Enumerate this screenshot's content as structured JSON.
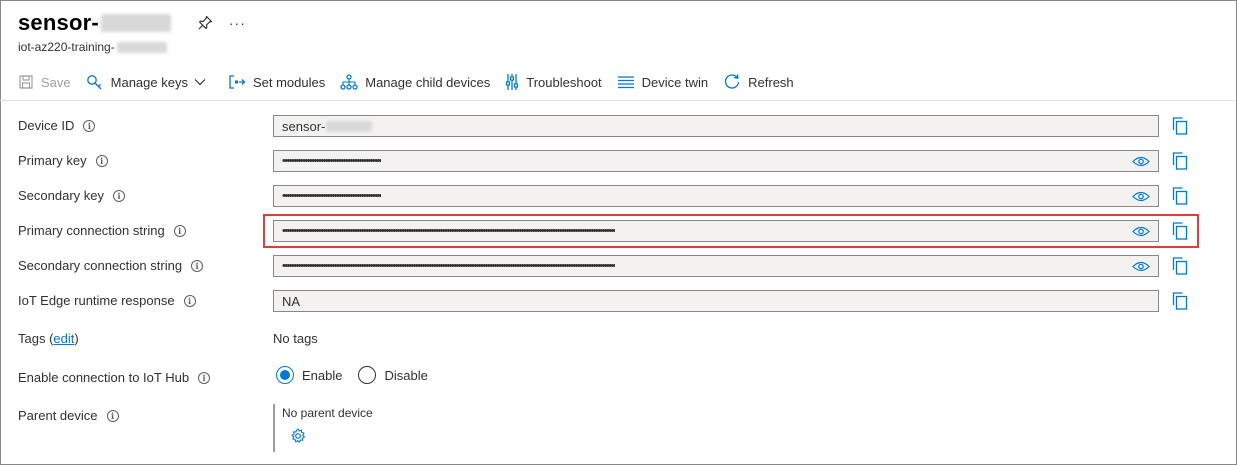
{
  "header": {
    "title": "sensor-",
    "subtitle": "iot-az220-training-",
    "more": "···"
  },
  "toolbar": {
    "save": "Save",
    "manage_keys": "Manage keys",
    "set_modules": "Set modules",
    "manage_child_devices": "Manage child devices",
    "troubleshoot": "Troubleshoot",
    "device_twin": "Device twin",
    "refresh": "Refresh"
  },
  "fields": {
    "device_id": {
      "label": "Device ID",
      "value": "sensor-"
    },
    "primary_key": {
      "label": "Primary key",
      "value": "••••••••••••••••••••••••••••••••••••••••••••"
    },
    "secondary_key": {
      "label": "Secondary key",
      "value": "••••••••••••••••••••••••••••••••••••••••••••"
    },
    "primary_conn": {
      "label": "Primary connection string",
      "value": "••••••••••••••••••••••••••••••••••••••••••••••••••••••••••••••••••••••••••••••••••••••••••••••••••••••••••••••••••••••••••••••••••••••••••••••••••••"
    },
    "secondary_conn": {
      "label": "Secondary connection string",
      "value": "••••••••••••••••••••••••••••••••••••••••••••••••••••••••••••••••••••••••••••••••••••••••••••••••••••••••••••••••••••••••••••••••••••••••••••••••••••"
    },
    "edge_runtime": {
      "label": "IoT Edge runtime response",
      "value": "NA"
    }
  },
  "tags": {
    "label": "Tags (",
    "edit": "edit",
    "close": ")",
    "value": "No tags"
  },
  "connection": {
    "label": "Enable connection to IoT Hub",
    "enable": "Enable",
    "disable": "Disable",
    "selected": "Enable"
  },
  "parent": {
    "label": "Parent device",
    "value": "No parent device"
  },
  "colors": {
    "accent": "#0078d4",
    "highlight": "#e03c3c"
  }
}
